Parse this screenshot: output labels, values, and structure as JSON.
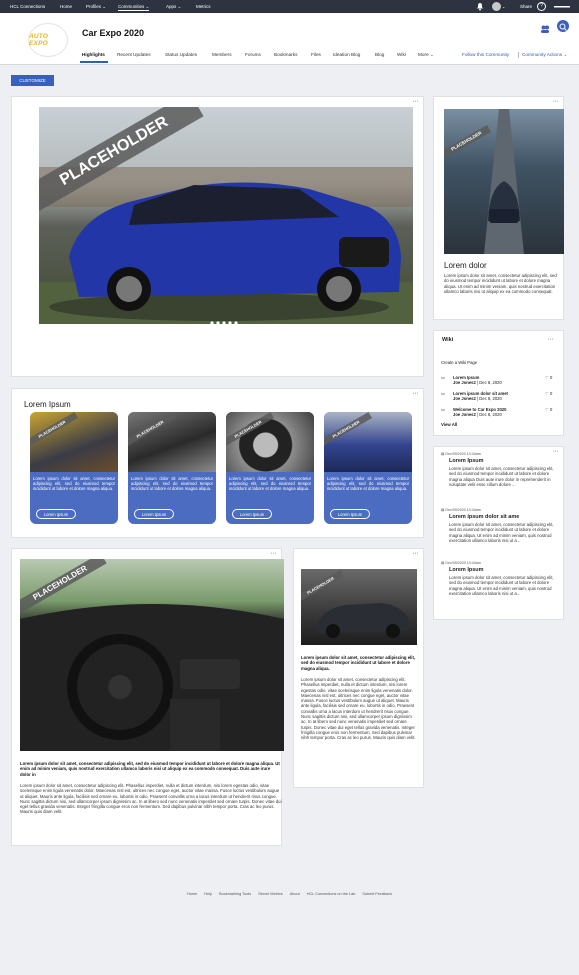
{
  "topnav": {
    "brand": "HCL Connections",
    "home": "Home",
    "profiles": "Profiles",
    "communities": "Communities",
    "apps": "Apps",
    "metrics": "Metrics",
    "share": "Share"
  },
  "header": {
    "logo_text": "AUTO EXPO",
    "title": "Car Expo 2020",
    "tabs": [
      "Highlights",
      "Recent Updates",
      "Status Updates",
      "Members",
      "Forums",
      "Bookmarks",
      "Files",
      "Ideation Blog",
      "Blog",
      "Wiki",
      "More"
    ],
    "follow": "Follow this Community",
    "actions": "Community Actions"
  },
  "customize": "CUSTOMIZE",
  "placeholder": "PLACEHOLDER",
  "side_top": {
    "title": "Lorem dolor",
    "body": "Lorem ipsum dolor sit amet, consectetur adipiscing elit, sed do eiusmod tempor incididunt ut labore et dolore magna aliqua. Ut enim ad minim veniam, quis nostrud exercitation ullamco laboris nisi ut aliquip ex ea commodo consequat."
  },
  "wiki": {
    "title": "Wiki",
    "create": "Create a Wiki Page",
    "items": [
      {
        "title": "Lorem Ipsum",
        "author": "Joe Jones2",
        "date": "Dec 8, 2020",
        "likes": "0"
      },
      {
        "title": "Lorem ipsum dolor sit amet",
        "author": "Joe Jones2",
        "date": "Dec 8, 2020",
        "likes": "0"
      },
      {
        "title": "Welcome to Car Expo 2020",
        "author": "Joe Jones2",
        "date": "Dec 8, 2020",
        "likes": "0"
      }
    ],
    "view_all": "View All"
  },
  "feed": [
    {
      "date": "Dec/09/2020 10:44am",
      "title": "Lorem Ipsum",
      "body": "Lorem ipsum dolor sit amet, consectetur adipiscing elit, sed do eiusmod tempor incididunt ut labore et dolore magna aliqua Duis aute irure dolor in reprehenderit in voluptate velit esse cillum dolore ..."
    },
    {
      "date": "Dec/09/2020 10:44am",
      "title": "Lorem ipsum dolor sit ame",
      "body": "Lorem ipsum dolor sit amet, consectetur adipiscing elit, sed do eiusmod tempor incididunt ut labore et dolore magna aliqua. Ut enim ad minim veniam, quis nostrud exercitation ullamco laboris nisi ut a..."
    },
    {
      "date": "Dec/09/2020 10:44am",
      "title": "Lorem Ipsum",
      "body": "Lorem ipsum dolor sit amet, consectetur adipiscing elit, sed do eiusmod tempor incididunt ut labore et dolore magna aliqua. Ut enim ad minim veniam, quis nostrud exercitation ullamco laboris nisi ut a..."
    }
  ],
  "lorem_section": {
    "title": "Lorem Ipsum",
    "card_text": "Lorem ipsum dolor sit amet, consectetur adipiscing elit, sed do eiusmod tempor incididunt ut labore et dolore magna aliqua.",
    "card_button": "Lorem Ipsum"
  },
  "bottom_left": {
    "lead": "Lorem ipsum dolor sit amet, consectetur adipiscing elit, sed do eiusmod tempor incididunt ut labore et dolore magna aliqua. Ut enim ad minim veniam, quis nostrud exercitation ullamco laboris nisi ut aliquip ex ea commodo consequat. Duis aute irure dolor in",
    "body": "Lorem ipsum dolor sit amet, consectetur adipiscing elit. Phasellus imperdiet, nulla et dictum interdum, nisi lorem egestas odio, vitae scelerisque enim ligula venenatis dolor. Maecenas nisl est, ultrices nec congue eget, auctor vitae massa. Fusce luctus vestibulum augue ut aliquet. Mauris ante ligula, facilisis sed ornare eu, lobortis in odio. Praesent convallis urna a lacus interdum ut hendrerit risus congue. Nunc sagittis dictum nisi, sed ullamcorper ipsum dignissim ac. In at libero sed nunc venenatis imperdiet sed ornare turpis. Donec vitae dui eget tellus gravida venenatis. Integer fringilla congue eros non fermentum. Sed dapibus pulvinar nibh tempor porta. Cras ac leo purus. Mauris quis diam velit."
  },
  "bottom_mid": {
    "lead": "Lorem ipsum dolor sit amet, consectetur adipiscing elit, sed do eiusmod tempor incididunt ut labore et dolore magna aliqua.",
    "body": "Lorem ipsum dolor sit amet, consectetur adipiscing elit. Phasellus imperdiet, nulla et dictum interdum, nisi lorem egestas odio, vitae scelerisque enim ligula venenatis dolor. Maecenas nisl est, ultrices nec congue eget, auctor vitae massa. Fusce luctus vestibulum augue ut aliquet. Mauris ante ligula, facilisis sed ornare eu, lobortis in odio. Praesent convallis urna a lacus interdum ut hendrerit risus congue. Nunc sagittis dictum nisi, sed ullamcorper ipsum dignissim ac. In at libero sed nunc venenatis imperdiet sed ornare turpis. Donec vitae dui eget tellus gravida venenatis. Integer fringilla congue eros non fermentum. Sed dapibus pulvinar nibh tempor porta. Cras ac leo purus. Mauris quis diam velit."
  },
  "footer": [
    "Home",
    "Help",
    "Bookmarking Tools",
    "Server Metrics",
    "About",
    "HCL Connections on the Lab",
    "Submit Feedback"
  ],
  "colors": {
    "nav": "#2f3241",
    "accent": "#3b5fbd",
    "card_blue": "#4c6cc1"
  }
}
